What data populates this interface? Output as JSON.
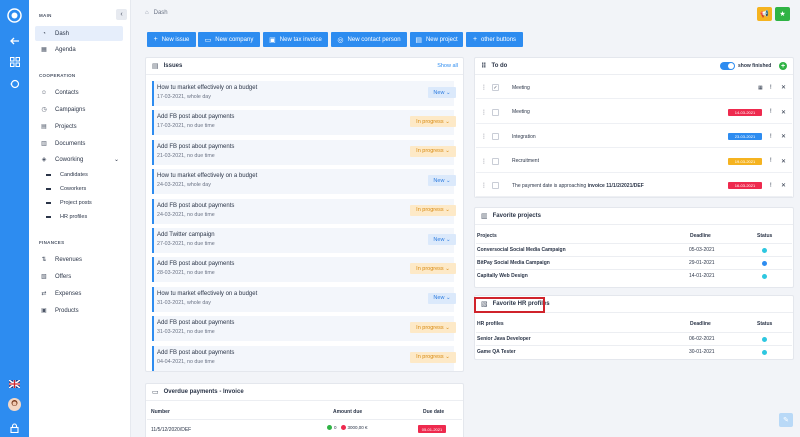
{
  "rail": {
    "icons": [
      "logo-icon",
      "back-arrow-icon",
      "grid-icon",
      "toggle-icon"
    ],
    "flag": "uk-flag-icon",
    "avatar": "avatar",
    "lock": "lock-icon"
  },
  "sidebar": {
    "main_label": "MAIN",
    "items_main": [
      {
        "label": "Dash",
        "icon": "dashboard-icon"
      },
      {
        "label": "Agenda",
        "icon": "calendar-icon"
      }
    ],
    "cooperation_label": "COOPERATION",
    "items_coop": [
      {
        "label": "Contacts",
        "icon": "contacts-icon"
      },
      {
        "label": "Campaigns",
        "icon": "campaigns-icon"
      },
      {
        "label": "Projects",
        "icon": "projects-icon"
      },
      {
        "label": "Documents",
        "icon": "documents-icon"
      },
      {
        "label": "Coworking",
        "icon": "coworking-icon"
      }
    ],
    "coworking_sub": [
      "Candidates",
      "Coworkers",
      "Project posts",
      "HR profiles"
    ],
    "finances_label": "FINANCES",
    "items_fin": [
      {
        "label": "Revenues",
        "icon": "revenues-icon"
      },
      {
        "label": "Offers",
        "icon": "offers-icon"
      },
      {
        "label": "Expenses",
        "icon": "expenses-icon"
      },
      {
        "label": "Products",
        "icon": "products-icon"
      }
    ]
  },
  "breadcrumb": "Dash",
  "quick_buttons": [
    {
      "label": "New issue",
      "icon": "+"
    },
    {
      "label": "New company",
      "icon": "▭"
    },
    {
      "label": "New tax invoice",
      "icon": "▣"
    },
    {
      "label": "New contact person",
      "icon": "◎"
    },
    {
      "label": "New project",
      "icon": "▤"
    },
    {
      "label": "other buttons",
      "icon": "+"
    }
  ],
  "issues": {
    "title": "Issues",
    "show_all": "Show all",
    "items": [
      {
        "title": "How tu market effectively on a budget",
        "date": "17-03-2021, whole day",
        "status": "New"
      },
      {
        "title": "Add FB post about payments",
        "date": "17-03-2021, no due time",
        "status": "In progress"
      },
      {
        "title": "Add FB post about payments",
        "date": "21-03-2021, no due time",
        "status": "In progress"
      },
      {
        "title": "How tu market effectively on a budget",
        "date": "24-03-2021, whole day",
        "status": "New"
      },
      {
        "title": "Add FB post about payments",
        "date": "24-03-2021, no due time",
        "status": "In progress"
      },
      {
        "title": "Add Twitter campaign",
        "date": "27-03-2021, no due time",
        "status": "New"
      },
      {
        "title": "Add FB post about payments",
        "date": "28-03-2021, no due time",
        "status": "In progress"
      },
      {
        "title": "How tu market effectively on a budget",
        "date": "31-03-2021, whole day",
        "status": "New"
      },
      {
        "title": "Add FB post about payments",
        "date": "31-03-2021, no due time",
        "status": "In progress"
      },
      {
        "title": "Add FB post about payments",
        "date": "04-04-2021, no due time",
        "status": "In progress"
      }
    ]
  },
  "overdue": {
    "title": "Overdue payments - Invoice",
    "headers": [
      "Number",
      "Amount due",
      "Due date"
    ],
    "rows": [
      {
        "number": "11/5/12/2020/DEF",
        "paid": "0",
        "due": "3000,00 €",
        "date": "05-01-2021"
      }
    ]
  },
  "todo": {
    "title": "To do",
    "show_finished": "show finished",
    "items": [
      {
        "text": "Meeting",
        "date": "",
        "checked": true,
        "color": ""
      },
      {
        "text": "Meeting",
        "date": "14-03-2021",
        "checked": false,
        "color": "#ee2a4e"
      },
      {
        "text": "Integration",
        "date": "23-03-2021",
        "checked": false,
        "color": "#2d8cf0"
      },
      {
        "text": "Recruitment",
        "date": "19-03-2021",
        "checked": false,
        "color": "#f5b320"
      },
      {
        "text": "The payment date is approaching",
        "bold": "invoice 11/1/2/2021/DEF",
        "date": "16-03-2021",
        "checked": false,
        "color": "#ee2a4e"
      }
    ]
  },
  "favorite_projects": {
    "title": "Favorite projects",
    "headers": [
      "Projects",
      "Deadline",
      "Status"
    ],
    "rows": [
      {
        "name": "Conversocial Social Media Campaign",
        "deadline": "05-03-2021",
        "status": "#2ec7e0"
      },
      {
        "name": "BitPay Social Media Campaign",
        "deadline": "29-01-2021",
        "status": "#2d8cf0"
      },
      {
        "name": "Capitally Web Design",
        "deadline": "14-01-2021",
        "status": "#2ec7e0"
      }
    ]
  },
  "favorite_hr": {
    "title": "Favorite HR profiles",
    "headers": [
      "HR profiles",
      "Deadline",
      "Status"
    ],
    "rows": [
      {
        "name": "Senior Java Developer",
        "deadline": "06-02-2021",
        "status": "#2ec7e0"
      },
      {
        "name": "Game QA Tester",
        "deadline": "30-01-2021",
        "status": "#2ec7e0"
      }
    ]
  },
  "colors": {
    "accent": "#2d8cf0",
    "warn": "#f5b320",
    "ok": "#2fb344",
    "danger": "#ee2a4e"
  }
}
